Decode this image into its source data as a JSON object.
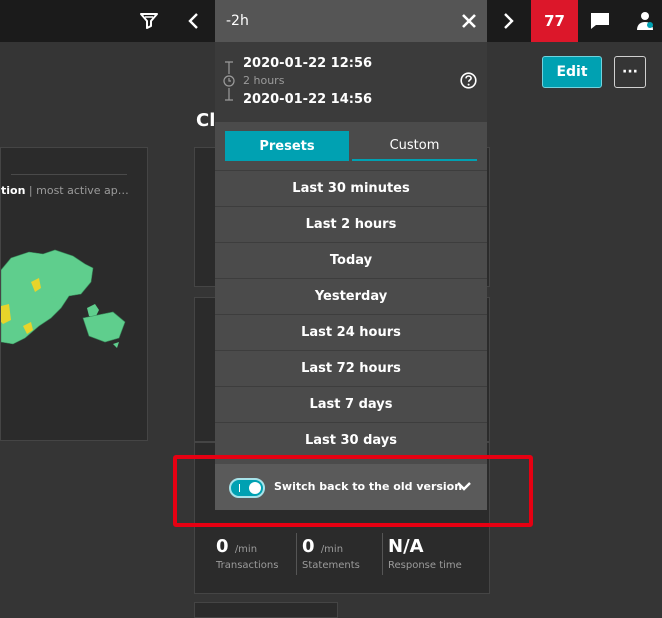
{
  "topbar": {
    "badge_count": "77",
    "icons": [
      "filter-icon",
      "chevron-left-icon",
      "close-icon",
      "chevron-right-icon",
      "chat-icon",
      "user-icon"
    ]
  },
  "timeframe": {
    "input_value": "-2h",
    "start": "2020-01-22 12:56",
    "duration": "2 hours",
    "end": "2020-01-22 14:56",
    "tabs": {
      "presets": "Presets",
      "custom": "Custom"
    },
    "presets": [
      "Last 30 minutes",
      "Last 2 hours",
      "Today",
      "Yesterday",
      "Last 24 hours",
      "Last 72 hours",
      "Last 7 days",
      "Last 30 days"
    ],
    "switch_label": "Switch back to the old version"
  },
  "dashboard": {
    "edit_label": "Edit",
    "more_label": "···",
    "section_title_partial": "Cl",
    "map_subtitle_bold": "tion",
    "map_subtitle_rest": " | most active ap…"
  },
  "stats": [
    {
      "value": "0",
      "unit": "/min",
      "label": "Transactions"
    },
    {
      "value": "0",
      "unit": "/min",
      "label": "Statements"
    },
    {
      "value": "N/A",
      "unit": "",
      "label": "Response time"
    }
  ],
  "colors": {
    "accent": "#00a1b2",
    "badge": "#dc172a",
    "highlight": "#e60012",
    "map_land": "#5fce8d"
  }
}
